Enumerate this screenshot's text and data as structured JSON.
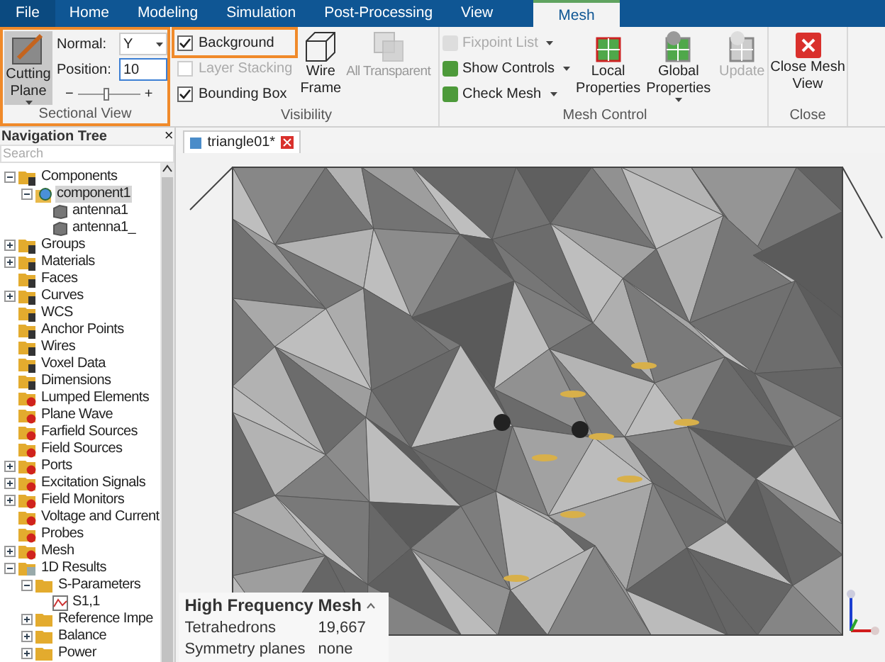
{
  "menu_tabs": [
    {
      "label": "File",
      "kind": "file",
      "selected": false
    },
    {
      "label": "Home",
      "kind": "tab",
      "selected": false
    },
    {
      "label": "Modeling",
      "kind": "tab",
      "selected": false
    },
    {
      "label": "Simulation",
      "kind": "tab",
      "selected": false
    },
    {
      "label": "Post-Processing",
      "kind": "tab",
      "selected": false
    },
    {
      "label": "View",
      "kind": "tab",
      "selected": false
    },
    {
      "label": "Mesh",
      "kind": "tab",
      "selected": true
    }
  ],
  "sectional_view": {
    "title": "Sectional View",
    "highlighted": true,
    "cutting_plane": {
      "label": "Cutting Plane",
      "selected": true
    },
    "normal_label": "Normal:",
    "normal_value": "Y",
    "position_label": "Position:",
    "position_value": "10",
    "slider_minus": "−",
    "slider_plus": "+",
    "level": 0.45
  },
  "visibility": {
    "title": "Visibility",
    "checkboxes": [
      {
        "label": "Background",
        "checked": true,
        "disabled": false,
        "highlighted": true
      },
      {
        "label": "Layer Stacking",
        "checked": false,
        "disabled": true,
        "highlighted": false
      },
      {
        "label": "Bounding Box",
        "checked": true,
        "disabled": false,
        "highlighted": false
      }
    ],
    "wire_frame": {
      "label": "Wire Frame",
      "disabled": false
    },
    "all_transparent": {
      "label": "All Transparent",
      "disabled": true
    }
  },
  "mesh_control": {
    "title": "Mesh Control",
    "small_buttons": [
      {
        "label": "Fixpoint List",
        "disabled": true
      },
      {
        "label": "Show Controls",
        "disabled": false
      },
      {
        "label": "Check Mesh",
        "disabled": false
      }
    ],
    "big_buttons": [
      {
        "label": "Local Properties",
        "kind": "local",
        "dropdown": false,
        "disabled": false
      },
      {
        "label": "Global Properties",
        "kind": "global",
        "dropdown": true,
        "disabled": false
      },
      {
        "label": "Update",
        "kind": "update",
        "dropdown": false,
        "disabled": true
      }
    ]
  },
  "close": {
    "title": "Close",
    "button": "Close Mesh View"
  },
  "navigation_tree": {
    "title": "Navigation Tree",
    "close": "×",
    "search_placeholder": "Search",
    "items": [
      {
        "label": "Components",
        "kind": "folder",
        "expanded": true,
        "children": [
          {
            "label": "component1",
            "kind": "component",
            "expanded": true,
            "selected": true,
            "children": [
              {
                "label": "antenna1",
                "kind": "solid"
              },
              {
                "label": "antenna1_",
                "kind": "solid"
              }
            ]
          }
        ]
      },
      {
        "label": "Groups",
        "kind": "folder",
        "expanded": false
      },
      {
        "label": "Materials",
        "kind": "folder",
        "expanded": false
      },
      {
        "label": "Faces",
        "kind": "folder"
      },
      {
        "label": "Curves",
        "kind": "folder",
        "expanded": false
      },
      {
        "label": "WCS",
        "kind": "folder"
      },
      {
        "label": "Anchor Points",
        "kind": "folder"
      },
      {
        "label": "Wires",
        "kind": "folder"
      },
      {
        "label": "Voxel Data",
        "kind": "folder"
      },
      {
        "label": "Dimensions",
        "kind": "folder"
      },
      {
        "label": "Lumped Elements",
        "kind": "source"
      },
      {
        "label": "Plane Wave",
        "kind": "source"
      },
      {
        "label": "Farfield Sources",
        "kind": "source"
      },
      {
        "label": "Field Sources",
        "kind": "source"
      },
      {
        "label": "Ports",
        "kind": "source",
        "expanded": false
      },
      {
        "label": "Excitation Signals",
        "kind": "source",
        "expanded": false
      },
      {
        "label": "Field Monitors",
        "kind": "source",
        "expanded": false
      },
      {
        "label": "Voltage and Current",
        "kind": "source"
      },
      {
        "label": "Probes",
        "kind": "source"
      },
      {
        "label": "Mesh",
        "kind": "source",
        "expanded": false
      },
      {
        "label": "1D Results",
        "kind": "results",
        "expanded": true,
        "children": [
          {
            "label": "S-Parameters",
            "kind": "plain",
            "expanded": true,
            "children": [
              {
                "label": "S1,1",
                "kind": "curve"
              }
            ]
          },
          {
            "label": "Reference Impe",
            "kind": "plain",
            "expanded": false
          },
          {
            "label": "Balance",
            "kind": "plain",
            "expanded": false
          },
          {
            "label": "Power",
            "kind": "plain",
            "expanded": false
          }
        ]
      }
    ]
  },
  "document_tab": {
    "label": "triangle01*"
  },
  "mesh_info": {
    "title": "High Frequency Mesh",
    "rows": [
      {
        "label": "Tetrahedrons",
        "value": "19,667"
      },
      {
        "label": "Symmetry planes",
        "value": "none"
      }
    ]
  }
}
